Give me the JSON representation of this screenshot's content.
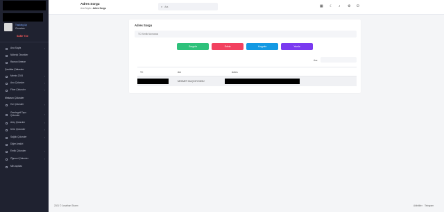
{
  "sidebar": {
    "user_status": "Tracking Up",
    "user_name": "Churches",
    "user_badge": "SuBe Yöe",
    "items": [
      {
        "label": "Ana Sayfa"
      },
      {
        "label": "Nöbetçi Öncekler"
      },
      {
        "label": "Ramon Breeze"
      },
      {
        "section": "Çeviribe Çiduruler"
      },
      {
        "label": "Mernis 2024"
      },
      {
        "label": "Ano Çiduruler"
      },
      {
        "label": "Fiber Çiduruler"
      },
      {
        "section": "Mekasın Çiduruler"
      },
      {
        "label": "Hız Çiduruler"
      },
      {
        "label": "Gerelegeli Tapu Çiduruler"
      },
      {
        "label": "Arüç Çiduruler"
      },
      {
        "label": "Ürün Çiduruler"
      },
      {
        "label": "Sağlık Çiduruler"
      },
      {
        "label": "Diğer Analizi"
      },
      {
        "label": "Emlik Çiduruler"
      },
      {
        "label": "Öğrenci Çiduruler"
      },
      {
        "label": "Mlis açıklaz"
      }
    ]
  },
  "header": {
    "title": "Adres Sorgu",
    "breadcrumb_home": "Ana Sayfa",
    "breadcrumb_sep": "•",
    "breadcrumb_current": "Adres Sorgu",
    "search_placeholder": "Ara"
  },
  "card": {
    "title": "Adres Sorgu",
    "tc_placeholder": "TC Kimlik Numarası",
    "buttons": {
      "green": "Sorgula",
      "red": "Sıfırla",
      "blue": "Kopyala",
      "purple": "Yazdır"
    },
    "filter_label": "Ara:",
    "table": {
      "headers": [
        "TC",
        "Adı",
        "Adres"
      ],
      "rows": [
        {
          "name": "MEHMET KILIÇKOYGÜSÜ"
        }
      ]
    }
  },
  "footer": {
    "copyright": "2021 © Jonathan Sharm",
    "link_1": "Aktivitiler",
    "link_2": "Telegram"
  },
  "colors": {
    "sidebar_bg": "#1f2230",
    "btn_green": "#2ec17b",
    "btn_red": "#f2415f",
    "btn_blue": "#1399e3",
    "btn_purple": "#7a3af0"
  }
}
